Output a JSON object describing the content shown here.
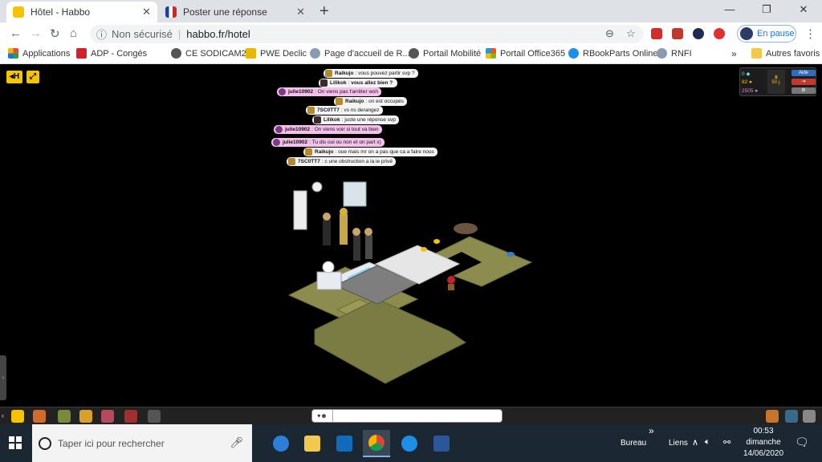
{
  "browser": {
    "tabs": [
      {
        "title": "Hôtel - Habbo",
        "active": true,
        "icon": "habbo-icon"
      },
      {
        "title": "Poster une réponse",
        "active": false,
        "icon": "france-flag-icon"
      }
    ],
    "new_tab": "+",
    "window_controls": {
      "minimize": "—",
      "restore": "❐",
      "close": "✕"
    },
    "nav": {
      "back": "←",
      "forward": "→",
      "reload": "↻",
      "home": "⌂"
    },
    "security_label": "Non sécurisé",
    "url": "habbo.fr/hotel",
    "profile_label": "En pause",
    "menu": "⋮",
    "bookmarks": [
      {
        "label": "Applications",
        "color": "#e0533a"
      },
      {
        "label": "ADP - Congés",
        "color": "#d3202a"
      },
      {
        "label": "CE SODICAM2",
        "color": "#555555"
      },
      {
        "label": "PWE Declic",
        "color": "#e6b800"
      },
      {
        "label": "Page d'accueil de R...",
        "color": "#8a9bb0"
      },
      {
        "label": "Portail Mobilité",
        "color": "#555555"
      },
      {
        "label": "Portail Office365",
        "color": "#e74c1c"
      },
      {
        "label": "RBookParts Online",
        "color": "#1f8ee6"
      },
      {
        "label": "RNFI",
        "color": "#8a9bb0"
      }
    ],
    "bookmarks_more": "»",
    "bookmarks_other": "Autres favoris"
  },
  "game": {
    "chat_messages": [
      {
        "user": "Raikujo",
        "text": "vous pouvez partir svp ?",
        "style": "gray",
        "avatar": "gold"
      },
      {
        "user": "Lilikok",
        "text": "vous allez bien ?",
        "style": "gray",
        "avatar": "dark"
      },
      {
        "user": "julie10902",
        "text": "On viens pas t'arrêter wsh",
        "style": "pink",
        "avatar": "purple"
      },
      {
        "user": "Raikujo",
        "text": "on est occupés",
        "style": "gray",
        "avatar": "gold"
      },
      {
        "user": "7SC0TT7",
        "text": "vs ns derangez",
        "style": "gray",
        "avatar": "gold"
      },
      {
        "user": "Lilikok",
        "text": "juste une réponse svp",
        "style": "gray",
        "avatar": "dark"
      },
      {
        "user": "julie10902",
        "text": "On viens voir si tout va bien",
        "style": "pink",
        "avatar": "purple"
      },
      {
        "user": "julie10902",
        "text": "Tu dis oui ou non et on part x)",
        "style": "pink",
        "avatar": "purple"
      },
      {
        "user": "Raikujo",
        "text": "oue mais mr on a pas que ca a faire nous",
        "style": "gray",
        "avatar": "gold"
      },
      {
        "user": "7SC0TT7",
        "text": "c une obstruction a la ie privé",
        "style": "gray",
        "avatar": "gold"
      }
    ],
    "stats": {
      "diamonds": "0",
      "credits": "82",
      "duckets": "2505",
      "club_days": "50 j.",
      "help_label": "Aide"
    },
    "chat_input": {
      "placeholder": "",
      "style_label": "▾"
    },
    "colors": {
      "pink_bubble": "#f6c0ec",
      "gray_bubble": "#f4f4f4",
      "habbo_yellow": "#f5c400"
    }
  },
  "taskbar": {
    "search_placeholder": "Taper ici pour rechercher",
    "apps": [
      "edge-legacy-icon",
      "file-explorer-icon",
      "outlook-icon",
      "chrome-icon",
      "edge-icon",
      "word-icon"
    ],
    "overflow": "»",
    "toolbar_bureau": "Bureau",
    "toolbar_liens": "Liens",
    "time": "00:53",
    "day": "dimanche",
    "date": "14/06/2020"
  }
}
